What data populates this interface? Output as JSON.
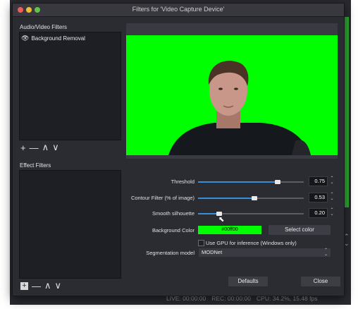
{
  "window": {
    "title": "Filters for 'Video Capture Device'"
  },
  "audio_video_filters": {
    "label": "Audio/Video Filters",
    "items": [
      {
        "label": "Background Removal",
        "icon": "eye-icon"
      }
    ],
    "controls": [
      "+",
      "—",
      "∧",
      "∨"
    ]
  },
  "effect_filters": {
    "label": "Effect Filters",
    "controls": [
      "+",
      "—",
      "∧",
      "∨"
    ]
  },
  "properties": {
    "threshold": {
      "label": "Threshold",
      "value": "0.75",
      "level": 0.75
    },
    "contour": {
      "label": "Contour Filter (% of image)",
      "value": "0.53",
      "level": 0.53
    },
    "smooth": {
      "label": "Smooth silhouette",
      "value": "0.20",
      "level": 0.2
    },
    "background_color": {
      "label": "Background Color",
      "value": "#00ff00",
      "button": "Select color"
    },
    "use_gpu": {
      "label": "Use GPU for inference (Windows only)",
      "checked": false
    },
    "segmentation_model": {
      "label": "Segmentation model",
      "value": "MODNet"
    }
  },
  "footer": {
    "defaults": "Defaults",
    "close": "Close"
  },
  "background_status": {
    "live": "LIVE: 00:00:00",
    "rec": "REC: 00:00:00",
    "cpu": "CPU: 34.2%, 15.48 fps"
  },
  "colors": {
    "chroma_green": "#00ff00",
    "accent_blue": "#3a8ed8"
  }
}
